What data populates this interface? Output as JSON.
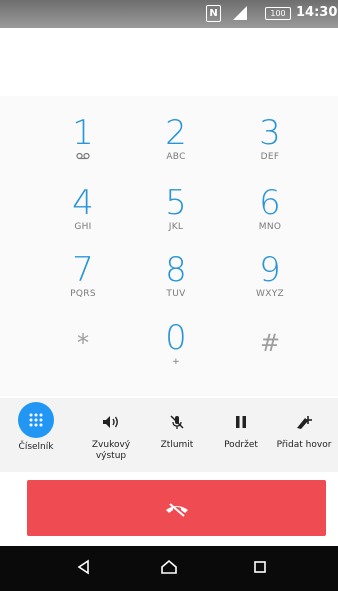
{
  "status": {
    "nfc": "N",
    "battery": "100",
    "time": "14:30"
  },
  "keypad": [
    {
      "digit": "1",
      "letters": "",
      "icon": "voicemail-icon"
    },
    {
      "digit": "2",
      "letters": "ABC"
    },
    {
      "digit": "3",
      "letters": "DEF"
    },
    {
      "digit": "4",
      "letters": "GHI"
    },
    {
      "digit": "5",
      "letters": "JKL"
    },
    {
      "digit": "6",
      "letters": "MNO"
    },
    {
      "digit": "7",
      "letters": "PQRS"
    },
    {
      "digit": "8",
      "letters": "TUV"
    },
    {
      "digit": "9",
      "letters": "WXYZ"
    },
    {
      "digit": "*",
      "letters": ""
    },
    {
      "digit": "0",
      "letters": "+"
    },
    {
      "digit": "#",
      "letters": ""
    }
  ],
  "actions": {
    "dialpad": "Číselník",
    "speaker_line1": "Zvukový",
    "speaker_line2": "výstup",
    "mute": "Ztlumit",
    "hold": "Podržet",
    "add_call": "Přidat hovor"
  },
  "colors": {
    "accent": "#2196f3",
    "digit": "#2a95d6",
    "end_call": "#ef4b52"
  },
  "icons": {
    "dialpad": "dialpad-grid-icon",
    "speaker": "speaker-icon",
    "mute": "mic-off-icon",
    "hold": "pause-icon",
    "add_call": "add-call-icon",
    "end_call": "call-end-icon",
    "back": "back-nav-icon",
    "home": "home-nav-icon",
    "recents": "recents-nav-icon"
  }
}
